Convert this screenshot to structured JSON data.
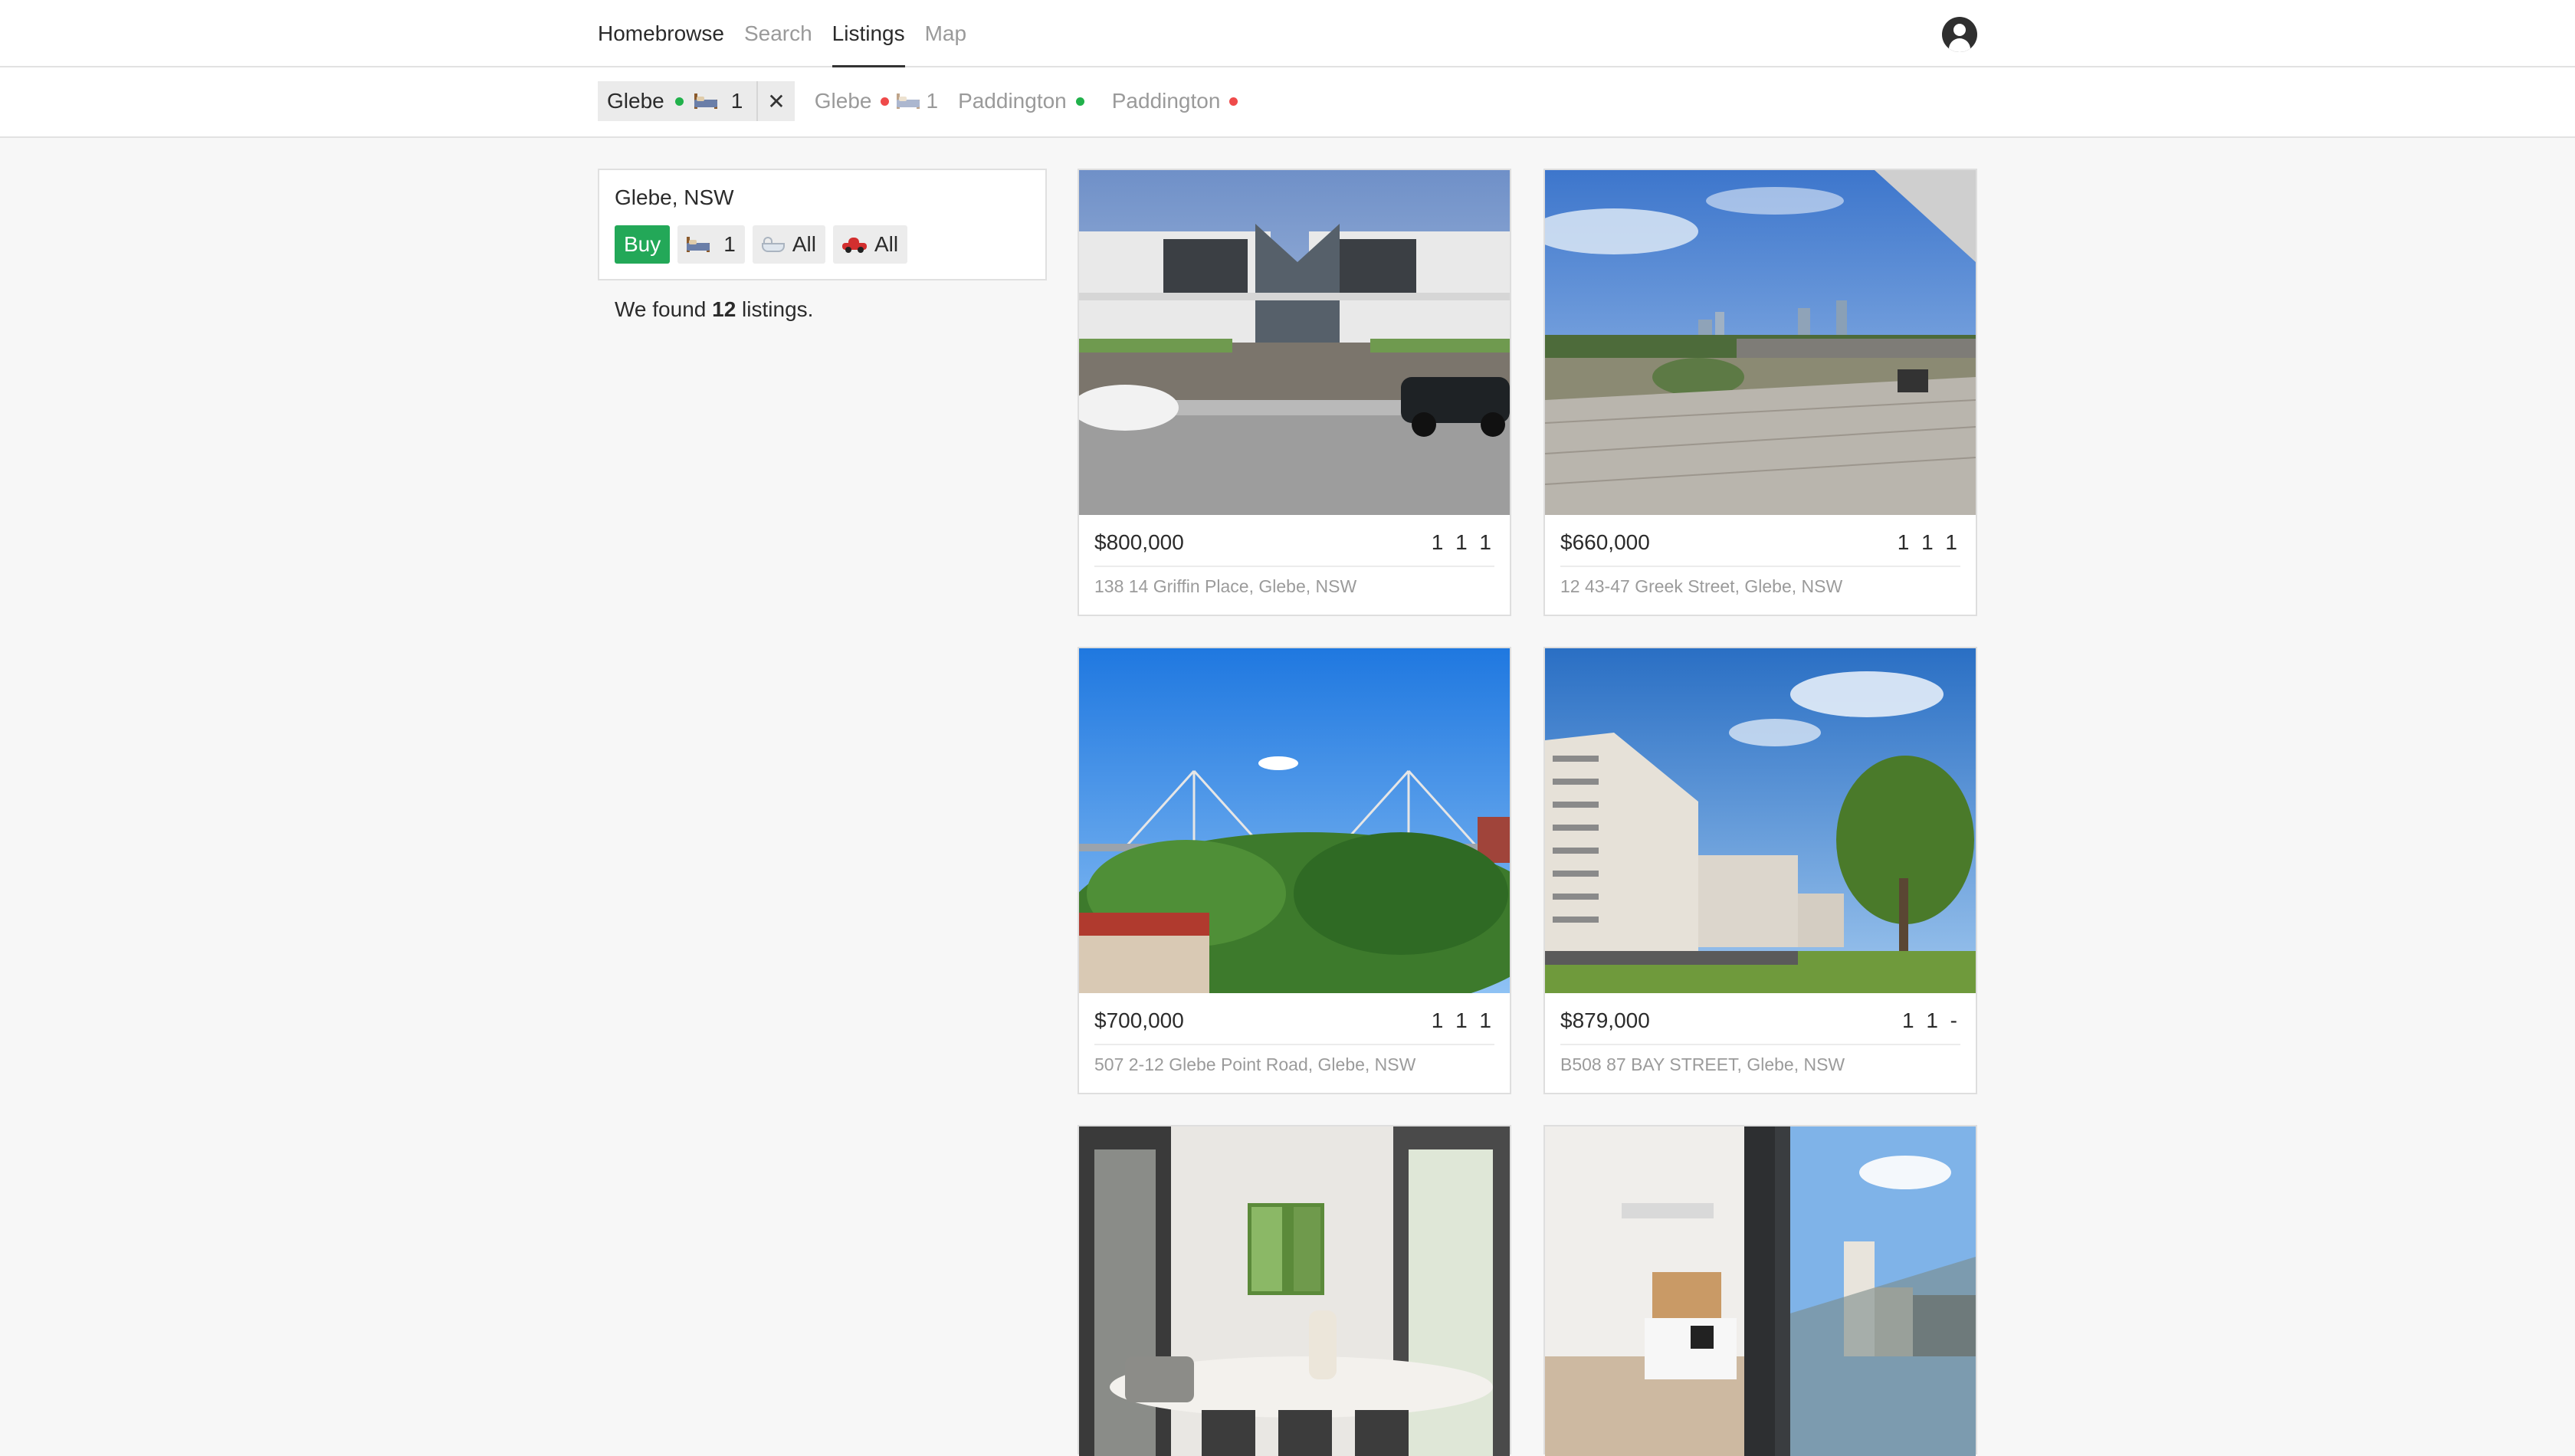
{
  "nav": {
    "brand": "Homebrowse",
    "items": [
      {
        "label": "Search",
        "active": false
      },
      {
        "label": "Listings",
        "active": true
      },
      {
        "label": "Map",
        "active": false
      }
    ]
  },
  "tabs": [
    {
      "name": "Glebe",
      "status": "green",
      "beds": "1",
      "active": true,
      "close": "✕"
    },
    {
      "name": "Glebe",
      "status": "red",
      "beds": "1",
      "active": false
    },
    {
      "name": "Paddington",
      "status": "green",
      "active": false
    },
    {
      "name": "Paddington",
      "status": "red",
      "active": false
    }
  ],
  "search": {
    "location": "Glebe, NSW",
    "mode": "Buy",
    "beds": "1",
    "baths": "All",
    "cars": "All"
  },
  "results": {
    "prefix": "We found ",
    "count": "12",
    "suffix": " listings."
  },
  "listings": [
    {
      "price": "$800,000",
      "specs": "1 1 1",
      "address": "138 14 Griffin Place, Glebe, NSW",
      "image": "modern-townhouses-street"
    },
    {
      "price": "$660,000",
      "specs": "1 1 1",
      "address": "12 43-47 Greek Street, Glebe, NSW",
      "image": "rooftop-deck-city-view"
    },
    {
      "price": "$700,000",
      "specs": "1 1 1",
      "address": "507 2-12 Glebe Point Road, Glebe, NSW",
      "image": "bridge-and-trees"
    },
    {
      "price": "$879,000",
      "specs": "1 1 -",
      "address": "B508 87 BAY STREET, Glebe, NSW",
      "image": "apartment-complex-park"
    },
    {
      "price": "",
      "specs": "",
      "address": "",
      "image": "dining-room-interior"
    },
    {
      "price": "",
      "specs": "",
      "address": "",
      "image": "apartment-kitchen-balcony"
    }
  ],
  "colors": {
    "buy": "#23a858",
    "status_green": "#21b14b",
    "status_red": "#ef4a4a"
  }
}
